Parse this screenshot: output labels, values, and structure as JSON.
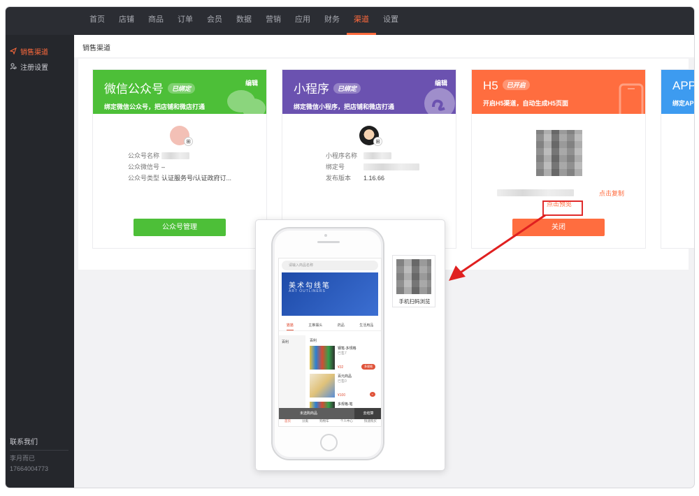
{
  "topnav": {
    "items": [
      "首页",
      "店铺",
      "商品",
      "订单",
      "会员",
      "数据",
      "营销",
      "应用",
      "财务",
      "渠道",
      "设置"
    ],
    "active_index": 9
  },
  "sidebar": {
    "items": [
      {
        "label": "销售渠道",
        "icon": "send-icon",
        "active": true
      },
      {
        "label": "注册设置",
        "icon": "user-settings-icon",
        "active": false
      }
    ],
    "contact": {
      "title": "联系我们",
      "name": "李月而已",
      "phone": "17664004773"
    }
  },
  "page": {
    "title": "销售渠道"
  },
  "cards": {
    "wechat": {
      "title": "微信公众号",
      "badge": "已绑定",
      "edit": "编辑",
      "desc": "绑定微信公众号，把店铺和微店打通",
      "color": "#4dbf38",
      "rows": [
        {
          "label": "公众号名称",
          "value": ""
        },
        {
          "label": "公众微信号",
          "value": "–"
        },
        {
          "label": "公众号类型",
          "value": "认证服务号/认证政府订..."
        }
      ],
      "button": "公众号管理",
      "button_color": "#4dbf38"
    },
    "miniprogram": {
      "title": "小程序",
      "badge": "已绑定",
      "edit": "编辑",
      "desc": "绑定微信小程序，把店铺和微店打通",
      "color": "#6b52b0",
      "rows": [
        {
          "label": "小程序名称",
          "value": ""
        },
        {
          "label": "绑定号",
          "value": ""
        },
        {
          "label": "发布版本",
          "value": "1.16.66"
        }
      ]
    },
    "h5": {
      "title": "H5",
      "badge": "已开启",
      "desc": "开启H5渠道，自动生成H5页面",
      "color": "#ff6d3f",
      "copy_link": "点击复制",
      "preview_link": "点击预览",
      "button": "关闭",
      "button_color": "#ff6d3f"
    },
    "app": {
      "title": "APP",
      "desc": "绑定APP",
      "color": "#3d9bf0"
    }
  },
  "preview_popup": {
    "qr_label": "手机扫码浏览",
    "phone": {
      "search_placeholder": "请输入商品名称",
      "banner_title": "美术勾线笔",
      "banner_subtitle": "ART OUTLINERS",
      "tabs": [
        "猫猫",
        "主推摆头",
        "药品",
        "生活用品"
      ],
      "category_side": "百利",
      "category_main": "百利",
      "products": [
        {
          "name": "钢笔-多规格",
          "sub": "已售7",
          "price": "¥32",
          "tag": "多规格"
        },
        {
          "name": "百元商品",
          "sub": "已售0",
          "price": "¥100",
          "tag": "+"
        },
        {
          "name": "多规格-笔",
          "sub": "",
          "price": "",
          "tag": ""
        }
      ],
      "cart_text": "未选购商品",
      "checkout": "去结算",
      "bottom_nav": [
        "首页",
        "分类",
        "购物车",
        "个人中心",
        "快速购买"
      ]
    }
  }
}
